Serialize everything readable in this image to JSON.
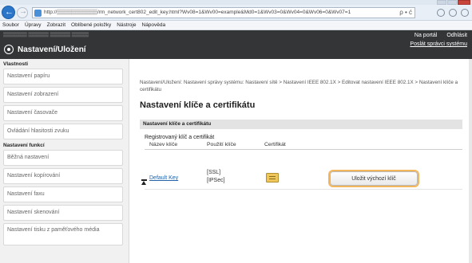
{
  "browser": {
    "url": "http://▒▒▒▒▒▒▒▒▒▒▒/rm_network_cert802_edit_key.html?Wv08=1&Wv00=example&Md0=1&Wv03=0&Wv04=0&Wv06=0&Wv07=1",
    "address_controls": "ρ • ć",
    "menu": [
      "Soubor",
      "Úpravy",
      "Zobrazit",
      "Oblíbené položky",
      "Nástroje",
      "Nápověda"
    ]
  },
  "header": {
    "host": "▒▒▒▒▒▒▒ ▒▒▒▒▒▒   ▒▒▒▒▒▒ ▒▒▒▒▒",
    "portal": "Na portál",
    "logout": "Odhlásit",
    "admin": "Poslát správci systému",
    "title": "Nastavení/Uložení"
  },
  "sidebar": {
    "section1": "Vlastnosti",
    "items1": [
      "Nastavení papíru",
      "Nastavení zobrazení",
      "Nastavení časovače",
      "Ovládání hlasitosti zvuku"
    ],
    "section2": "Nastavení funkcí",
    "items2": [
      "Běžná nastavení",
      "Nastavení kopírování",
      "Nastavení faxu",
      "Nastavení skenování",
      "Nastavení tisku z paměťového média"
    ]
  },
  "main": {
    "breadcrumb": "Nastavení/Uložení: Nastavení správy systému: Nastavení sítě > Nastavení IEEE 802.1X > Editovat nastavení IEEE 802.1X > Nastavení klíče a certifikátu",
    "title": "Nastavení klíče a certifikátu",
    "panel_title": "Nastavení klíče a certifikátu",
    "subheading": "Registrovaný klíč a certifikát",
    "columns": [
      "Název klíče",
      "Použití klíče",
      "Certifikát"
    ],
    "row": {
      "key_name": "Default Key",
      "usage_1": "[SSL]",
      "usage_2": "[IPSec]",
      "action": "Uložit výchozí klíč"
    }
  },
  "icons": [
    "back-icon",
    "forward-icon",
    "home-icon",
    "star-icon",
    "settings-icon",
    "gear-icon",
    "certificate-icon",
    "to-top-icon"
  ],
  "colors": {
    "header_bg": "#333537",
    "highlight": "#f4b65a",
    "link": "#2463a8"
  }
}
